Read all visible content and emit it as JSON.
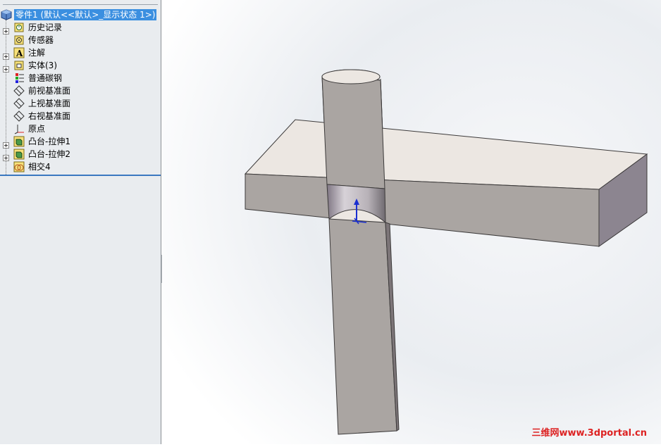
{
  "tree": {
    "root_label": "零件1 (默认<<默认>_显示状态 1>)",
    "items": [
      {
        "label": "历史记录",
        "expandable": true,
        "icon": "history-icon"
      },
      {
        "label": "传感器",
        "expandable": false,
        "icon": "sensor-icon"
      },
      {
        "label": "注解",
        "expandable": true,
        "icon": "annotation-icon"
      },
      {
        "label": "实体(3)",
        "expandable": true,
        "icon": "solid-bodies-icon"
      },
      {
        "label": "普通碳钢",
        "expandable": false,
        "icon": "material-icon"
      },
      {
        "label": "前视基准面",
        "expandable": false,
        "icon": "plane-icon"
      },
      {
        "label": "上视基准面",
        "expandable": false,
        "icon": "plane-icon"
      },
      {
        "label": "右视基准面",
        "expandable": false,
        "icon": "plane-icon"
      },
      {
        "label": "原点",
        "expandable": false,
        "icon": "origin-icon"
      },
      {
        "label": "凸台-拉伸1",
        "expandable": true,
        "icon": "extrude-icon"
      },
      {
        "label": "凸台-拉伸2",
        "expandable": true,
        "icon": "extrude-icon"
      },
      {
        "label": "相交4",
        "expandable": false,
        "icon": "intersect-icon"
      }
    ]
  },
  "watermark": "三维网www.3dportal.cn",
  "colors": {
    "selection": "#3b8fe0",
    "panel": "#e9ecef",
    "accent": "#3a78c0"
  }
}
